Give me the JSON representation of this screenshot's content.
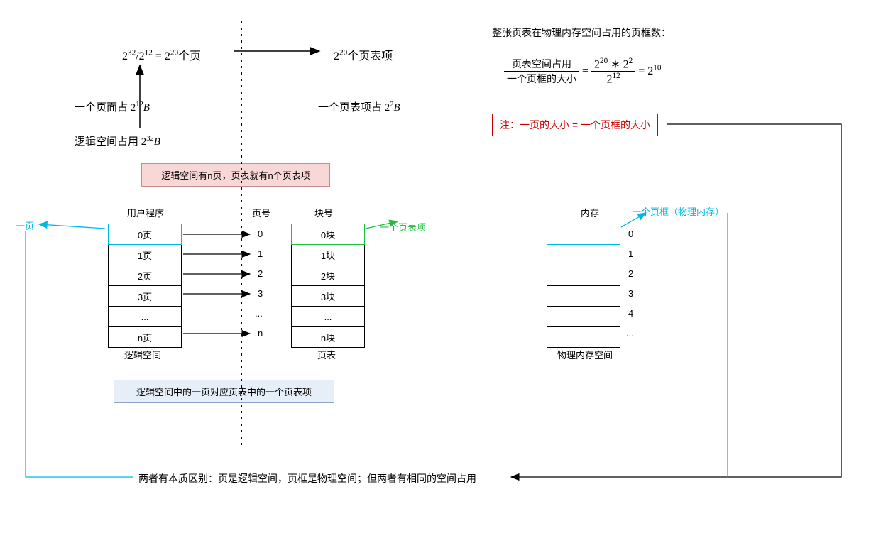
{
  "top": {
    "eq1_html": "2<sup>32</sup>/2<sup>12</sup> = 2<sup>20</sup>个页",
    "eq2_html": "2<sup>20</sup>个页表项",
    "line2_html": "一个页面占 2<sup>12</sup><i>B</i>",
    "line3_html": "逻辑空间占用 2<sup>32</sup><i>B</i>",
    "entry_size_html": "一个页表项占 2<sup>2</sup><i>B</i>"
  },
  "right": {
    "heading": "整张页表在物理内存空间占用的页框数：",
    "frac1_num": "页表空间占用",
    "frac1_den": "一个页框的大小",
    "eq": " = ",
    "frac2_num_html": "2<sup>20</sup> ∗ 2<sup>2</sup>",
    "frac2_den_html": "2<sup>12</sup>",
    "result_html": " = 2<sup>10</sup>",
    "note": "注：一页的大小 = 一个页框的大小"
  },
  "pink_box": "逻辑空间有n页，页表就有n个页表项",
  "blue_box": "逻辑空间中的一页对应页表中的一个页表项",
  "labels": {
    "user_prog": "用户程序",
    "page_no": "页号",
    "block_no": "块号",
    "memory": "内存",
    "logic_space": "逻辑空间",
    "page_table": "页表",
    "phys_space": "物理内存空间",
    "page_frame_cyan": "一个页框（物理内存）",
    "one_page_cyan": "一页",
    "one_entry_green": "一个页表项"
  },
  "logic_table": [
    "0页",
    "1页",
    "2页",
    "3页",
    "...",
    "n页"
  ],
  "page_numbers": [
    "0",
    "1",
    "2",
    "3",
    "...",
    "n"
  ],
  "block_table": [
    "0块",
    "1块",
    "2块",
    "3块",
    "...",
    "n块"
  ],
  "mem_rows": [
    " ",
    " ",
    " ",
    " ",
    " ",
    " "
  ],
  "mem_numbers": [
    "0",
    "1",
    "2",
    "3",
    "4",
    "..."
  ],
  "bottom_text": "两者有本质区别：页是逻辑空间，页框是物理空间；但两者有相同的空间占用"
}
